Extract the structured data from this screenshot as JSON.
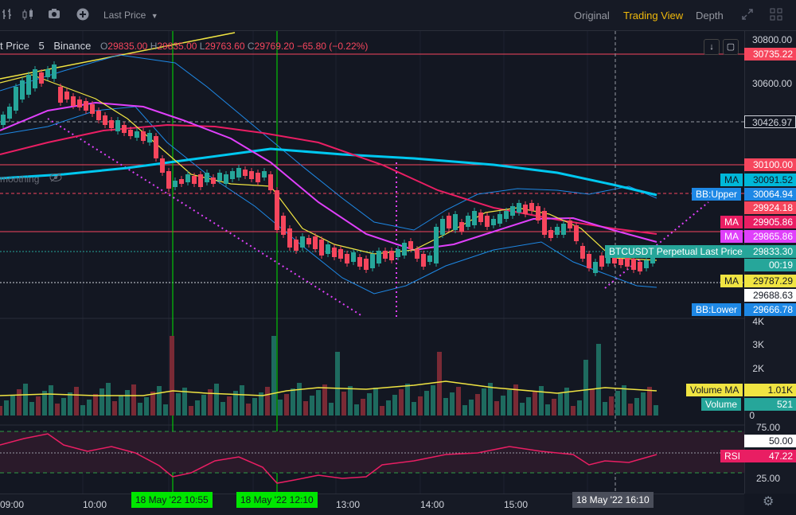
{
  "toolbar": {
    "price_type": "Last Price",
    "tabs": [
      {
        "label": "Original",
        "active": false
      },
      {
        "label": "Trading View",
        "active": true
      },
      {
        "label": "Depth",
        "active": false
      }
    ]
  },
  "legend": {
    "title": "t Price",
    "interval": "5",
    "exchange": "Binance",
    "o_key": "O",
    "o": "29835.00",
    "h_key": "H",
    "h": "29835.00",
    "l_key": "L",
    "l": "29763.60",
    "c_key": "C",
    "c": "29769.20",
    "change": "−65.80 (−0.22%)"
  },
  "smoothing_label": "moothing",
  "price_axis": {
    "ticks": [
      "30800.00",
      "30600.00",
      "30426.97",
      "30100.00"
    ],
    "labels": [
      {
        "text": "30735.22",
        "bg": "#f6465d",
        "fg": "#ffffff"
      },
      {
        "text": "30426.97",
        "bg": "#131722",
        "fg": "#d1d4dc"
      },
      {
        "text": "30100.00",
        "bg": "#f6465d",
        "fg": "#ffffff"
      },
      {
        "text": "30091.52",
        "bg": "#00b8d9",
        "fg": "#131722"
      },
      {
        "text": "30064.94",
        "bg": "#1e88e5",
        "fg": "#ffffff"
      },
      {
        "text": "29924.18",
        "bg": "#f6465d",
        "fg": "#ffffff"
      },
      {
        "text": "29905.86",
        "bg": "#e91e63",
        "fg": "#ffffff"
      },
      {
        "text": "29865.86",
        "bg": "#e040fb",
        "fg": "#ffffff"
      },
      {
        "text": "29833.30",
        "bg": "#26a69a",
        "fg": "#ffffff"
      },
      {
        "text": "00:19",
        "bg": "#26a69a",
        "fg": "#ffffff"
      },
      {
        "text": "29787.29",
        "bg": "#f0e442",
        "fg": "#131722"
      },
      {
        "text": "29688.63",
        "bg": "#ffffff",
        "fg": "#131722"
      },
      {
        "text": "29666.78",
        "bg": "#1e88e5",
        "fg": "#ffffff"
      }
    ],
    "indicator_tags": [
      {
        "text": "MA",
        "bg": "#00b8d9",
        "fg": "#131722"
      },
      {
        "text": "BB:Upper",
        "bg": "#1e88e5",
        "fg": "#ffffff"
      },
      {
        "text": "MA",
        "bg": "#e91e63",
        "fg": "#ffffff"
      },
      {
        "text": "MA",
        "bg": "#e040fb",
        "fg": "#ffffff"
      },
      {
        "text": "BTCUSDT Perpetual Last Price",
        "bg": "#26a69a",
        "fg": "#ffffff"
      },
      {
        "text": "MA",
        "bg": "#f0e442",
        "fg": "#131722"
      },
      {
        "text": "BB:Lower",
        "bg": "#1e88e5",
        "fg": "#ffffff"
      }
    ]
  },
  "volume_axis": {
    "ticks": [
      "4K",
      "3K",
      "2K",
      "0"
    ],
    "ma_label": "Volume MA",
    "ma_value": "1.01K",
    "vol_label": "Volume",
    "vol_value": "521"
  },
  "rsi_axis": {
    "ticks": [
      "75.00",
      "25.00"
    ],
    "level_value": "50.00",
    "rsi_label": "RSI",
    "rsi_value": "47.22"
  },
  "time_axis": {
    "ticks": [
      "09:00",
      "10:00",
      "13:00",
      "14:00",
      "15:00"
    ],
    "markers": [
      {
        "text": "18 May '22   10:55",
        "bg": "#00e600",
        "fg": "#131722"
      },
      {
        "text": "18 May '22   12:10",
        "bg": "#00e600",
        "fg": "#131722"
      },
      {
        "text": "18 May '22   16:10",
        "bg": "#4a4e5a",
        "fg": "#ffffff"
      }
    ]
  },
  "colors": {
    "up": "#26a69a",
    "down": "#f6465d",
    "ma_cyan": "#00c8f0",
    "ma_red": "#e91e63",
    "ma_magenta": "#e040fb",
    "ma_yellow": "#f0e442",
    "bollinger": "#1e88e5",
    "rsi": "#e91e63",
    "accent": "#f0b90b"
  }
}
